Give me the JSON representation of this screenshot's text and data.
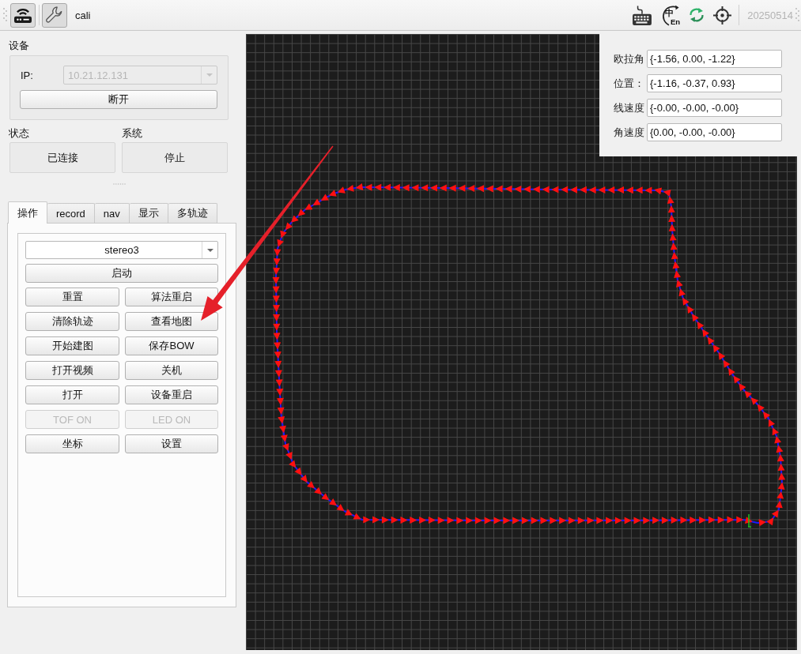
{
  "toolbar": {
    "buttons": [
      {
        "checked": true
      },
      {
        "checked": true
      }
    ],
    "title": "cali",
    "ime_icon": {
      "script": "中",
      "latin": "En"
    },
    "date": "20250514"
  },
  "device": {
    "title": "设备",
    "ip_label": "IP:",
    "ip_field": {
      "value": "10.21.12.131",
      "disabled": true
    },
    "disconnect_button": "断开"
  },
  "status": {
    "title": "状态",
    "value": "已连接"
  },
  "system": {
    "title": "系统",
    "value": "停止"
  },
  "tabs": [
    {
      "label": "操作",
      "selected": true
    },
    {
      "label": "record",
      "selected": false
    },
    {
      "label": "nav",
      "selected": false
    },
    {
      "label": "显示",
      "selected": false
    },
    {
      "label": "多轨迹",
      "selected": false
    }
  ],
  "operations": {
    "mode_select": "stereo3",
    "start_button": "启动",
    "buttons": [
      {
        "label": "重置",
        "disabled": false
      },
      {
        "label": "算法重启",
        "disabled": false
      },
      {
        "label": "清除轨迹",
        "disabled": false
      },
      {
        "label": "查看地图",
        "disabled": false
      },
      {
        "label": "开始建图",
        "disabled": false
      },
      {
        "label": "保存BOW",
        "disabled": false
      },
      {
        "label": "打开视频",
        "disabled": false
      },
      {
        "label": "关机",
        "disabled": false
      },
      {
        "label": "打开",
        "disabled": false
      },
      {
        "label": "设备重启",
        "disabled": false
      },
      {
        "label": "TOF ON",
        "disabled": true
      },
      {
        "label": "LED ON",
        "disabled": true
      },
      {
        "label": "坐标",
        "disabled": false
      },
      {
        "label": "设置",
        "disabled": false
      }
    ]
  },
  "pose": [
    {
      "label": "欧拉角",
      "value": "{-1.56, 0.00, -1.22}"
    },
    {
      "label": "位置：",
      "value": "{-1.16, -0.37, 0.93}"
    },
    {
      "label": "线速度",
      "value": "{-0.00, -0.00, -0.00}"
    },
    {
      "label": "角速度",
      "value": "{0.00, -0.00, -0.00}"
    }
  ]
}
